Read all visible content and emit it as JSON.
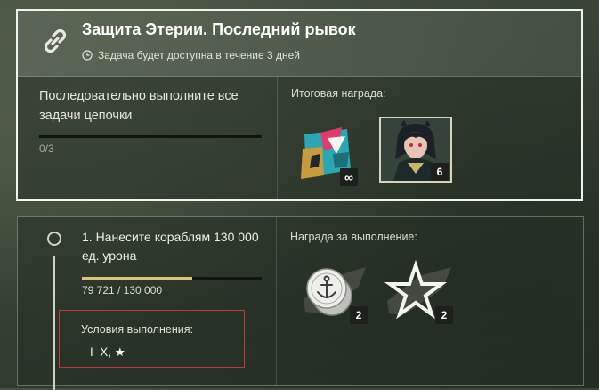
{
  "mission": {
    "title": "Защита Этерии. Последний рывок",
    "availability": "Задача будет доступна в течение 3 дней",
    "chain_text": "Последовательно выполните все задачи цепочки",
    "chain_progress": {
      "text": "0/3",
      "fraction": 0.0
    },
    "final_reward": {
      "label": "Итоговая награда:",
      "items": [
        {
          "icon": "camouflage-icon",
          "badge": "∞"
        },
        {
          "icon": "commander-portrait",
          "badge": "6"
        }
      ]
    }
  },
  "task": {
    "text": "1. Нанесите кораблям 130 000 ед. урона",
    "progress": {
      "text": "79 721 / 130 000",
      "fraction": 0.613
    },
    "conditions_label": "Условия выполнения:",
    "conditions_value": "I–X, ★",
    "reward": {
      "label": "Награда за выполнение:",
      "items": [
        {
          "icon": "silver-coin-icon",
          "badge": "2"
        },
        {
          "icon": "star-icon",
          "badge": "2"
        }
      ]
    }
  },
  "colors": {
    "progress_fill": "#d9c27c",
    "highlight_border": "#f2f2ee",
    "conditions_border": "#c23a33"
  }
}
